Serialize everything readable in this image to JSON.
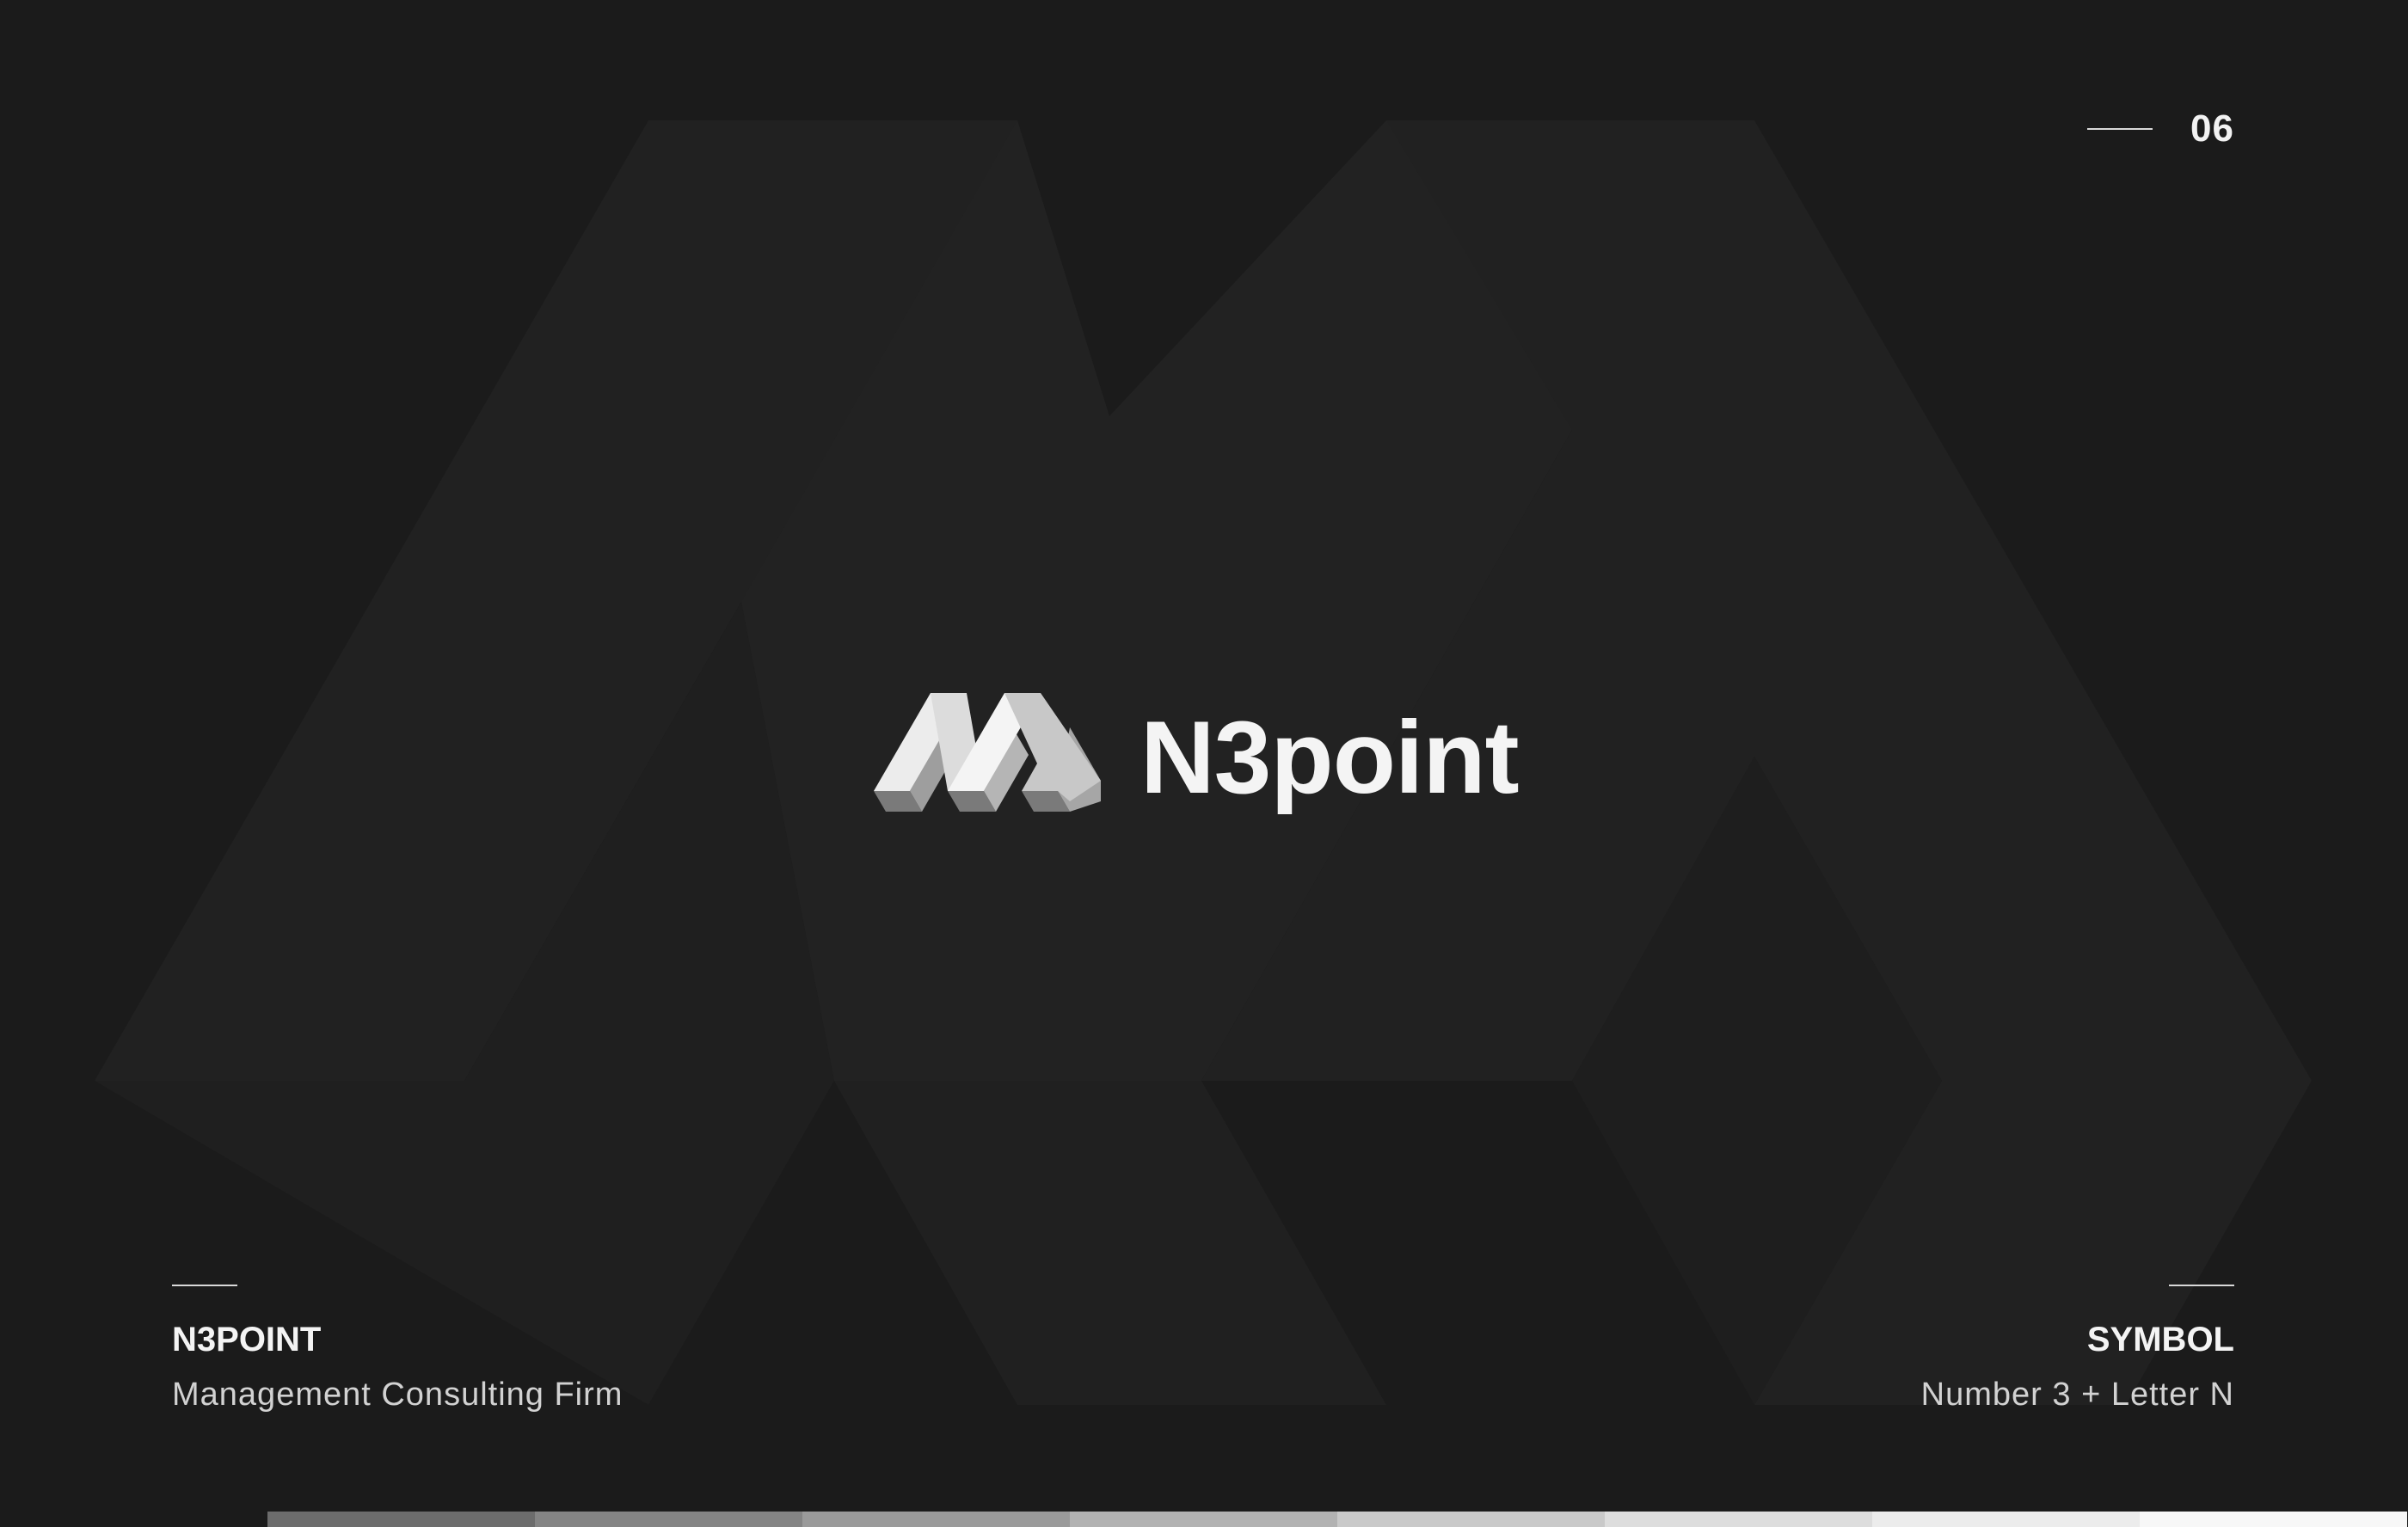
{
  "page": {
    "number": "06",
    "background_color": "#1b1b1b"
  },
  "logo": {
    "wordmark": "N3point",
    "symbol_icon": "n3-symbol-icon"
  },
  "left_caption": {
    "title": "N3POINT",
    "subtitle": "Management Consulting Firm"
  },
  "right_caption": {
    "title": "SYMBOL",
    "subtitle": "Number 3 + Letter N"
  },
  "palette": {
    "swatches": [
      "#6c6c6c",
      "#848484",
      "#9a9a9a",
      "#b2b2b2",
      "#c9c9c9",
      "#dddddd",
      "#ececec",
      "#f7f7f7"
    ]
  }
}
